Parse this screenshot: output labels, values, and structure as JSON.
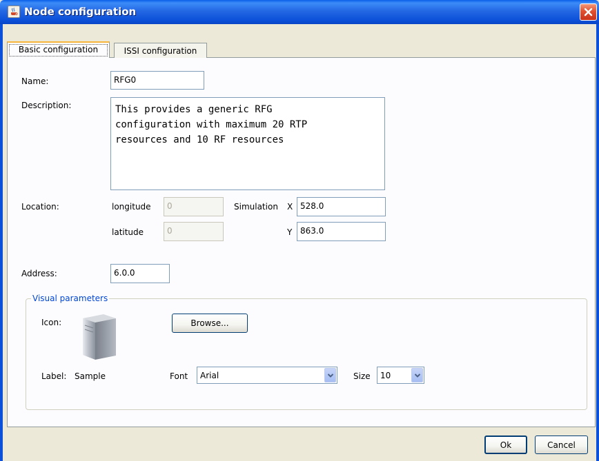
{
  "window": {
    "title": "Node configuration",
    "app_icon": "java-cup-icon",
    "close_icon": "close-icon"
  },
  "tabs": [
    {
      "label": "Basic configuration",
      "selected": true
    },
    {
      "label": "ISSI configuration",
      "selected": false
    }
  ],
  "form": {
    "name_label": "Name:",
    "name_value": "RFG0",
    "description_label": "Description:",
    "description_lines": [
      "This provides a generic RFG",
      "configuration with maximum 20 RTP",
      "resources and 10 RF resources"
    ],
    "location_label": "Location:",
    "longitude_label": "longitude",
    "longitude_value": "0",
    "latitude_label": "latitude",
    "latitude_value": "0",
    "simulation_label": "Simulation",
    "x_label": "X",
    "x_value": "528.0",
    "y_label": "Y",
    "y_value": "863.0",
    "address_label": "Address:",
    "address_value": "6.0.0"
  },
  "visual": {
    "group_title": "Visual parameters",
    "icon_label": "Icon:",
    "icon_preview": "server-tower-icon",
    "browse_label": "Browse...",
    "label_label": "Label:",
    "label_value": "Sample",
    "font_label": "Font",
    "font_value": "Arial",
    "size_label": "Size",
    "size_value": "10"
  },
  "buttons": {
    "ok_label": "Ok",
    "cancel_label": "Cancel"
  },
  "colors": {
    "titlebar": "#0A5FE8",
    "group_title": "#0046D5",
    "selected_tab_accent": "#F7B53C"
  }
}
